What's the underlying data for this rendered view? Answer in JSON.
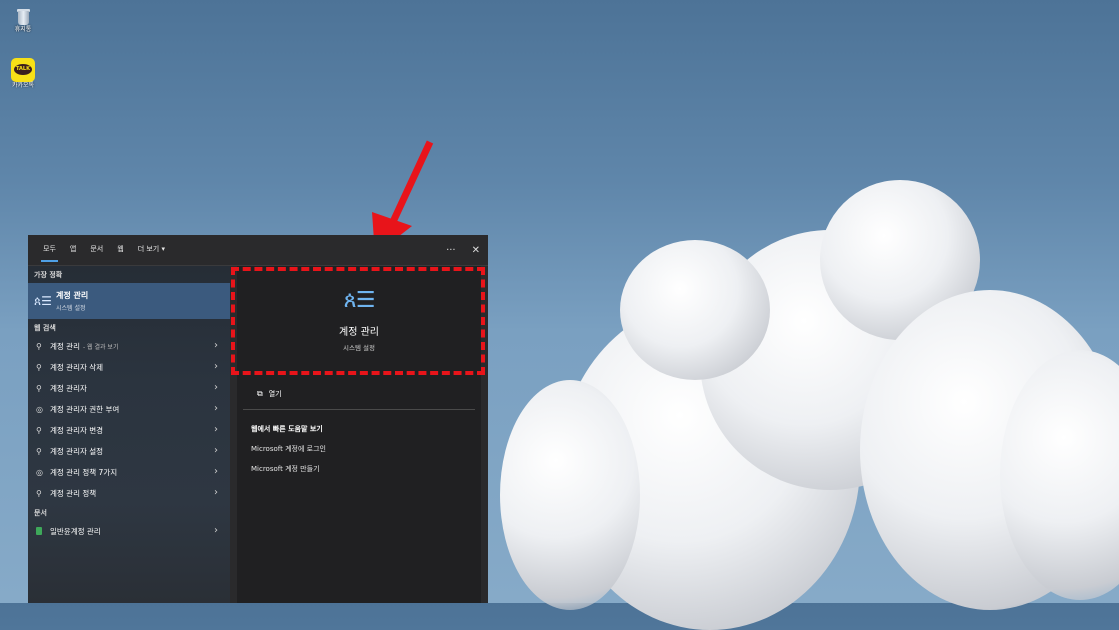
{
  "desktop": {
    "icons": [
      {
        "label": "휴지통",
        "icon": "recycle-bin-icon"
      },
      {
        "label": "카카오톡",
        "icon": "kakaotalk-icon",
        "glyph": "TALK"
      }
    ]
  },
  "search": {
    "tabs": [
      "모두",
      "앱",
      "문서",
      "웹",
      "더 보기 ▾"
    ],
    "more_icon": "···",
    "close_icon": "✕",
    "best_match_header": "가장 정확",
    "best_match": {
      "title": "계정 관리",
      "subtitle": "시스템 설정"
    },
    "web_header": "웹 검색",
    "web_results": [
      {
        "text": "계정 관리",
        "sub": "- 웹 결과 보기"
      },
      {
        "text": "계정 관리자 삭제",
        "sub": ""
      },
      {
        "text": "계정 관리자",
        "sub": ""
      },
      {
        "text": "계정 관리자 권한 부여",
        "sub": ""
      },
      {
        "text": "계정 관리자 변경",
        "sub": ""
      },
      {
        "text": "계정 관리자 설정",
        "sub": ""
      },
      {
        "text": "계정 관리 정책 7가지",
        "sub": ""
      },
      {
        "text": "계정 관리 정책",
        "sub": ""
      }
    ],
    "docs_header": "문서",
    "doc_results": [
      {
        "text": "일반윤계정 관리"
      }
    ],
    "detail": {
      "title": "계정 관리",
      "subtitle": "시스템 설정",
      "open_label": "열기",
      "web_title": "웹에서 빠른 도움말 보기",
      "links": [
        "Microsoft 계정에 로그인",
        "Microsoft 계정 만들기"
      ]
    }
  },
  "colors": {
    "highlight_box": "#e8141a",
    "arrow": "#e8141a",
    "accent": "#4fa0e6"
  }
}
